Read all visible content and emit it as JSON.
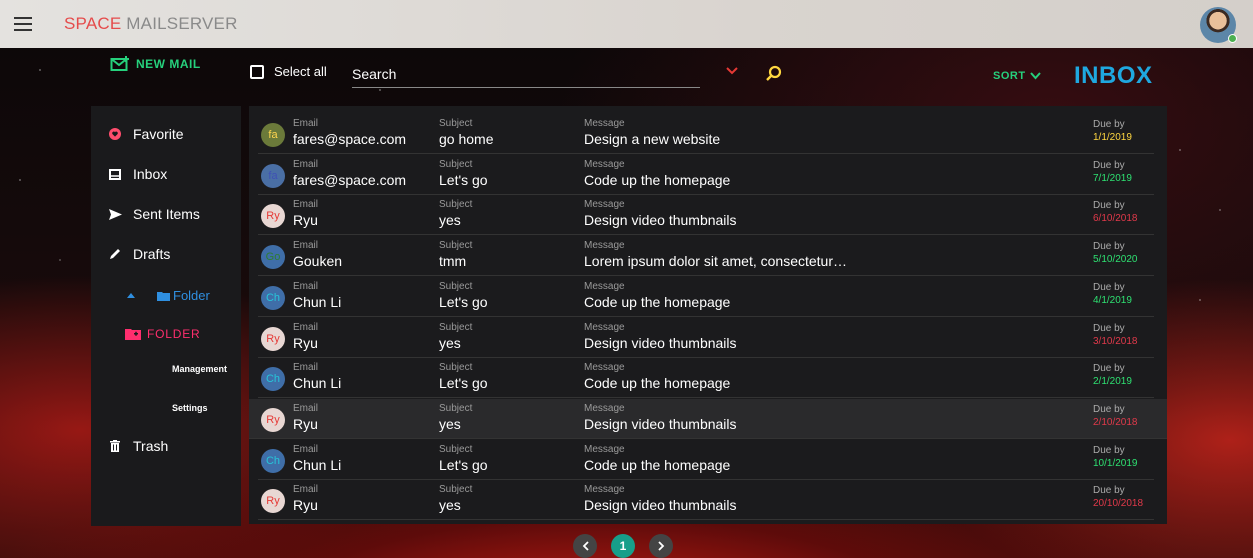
{
  "app": {
    "title_part1": "SPACE",
    "title_part2": " MAILSERVER"
  },
  "toolbar": {
    "new_mail": "NEW MAIL",
    "select_all": "Select all",
    "search_placeholder": "Search",
    "sort": "SORT",
    "inbox": "INBOX"
  },
  "sidebar": {
    "favorite": "Favorite",
    "inbox": "Inbox",
    "sent": "Sent Items",
    "drafts": "Drafts",
    "folder": "Folder",
    "folder2": "FOLDER",
    "management": "Management",
    "settings": "Settings",
    "trash": "Trash"
  },
  "labels": {
    "email": "Email",
    "subject": "Subject",
    "message": "Message",
    "due": "Due by"
  },
  "mails": [
    {
      "initials": "fa",
      "avatar_bg": "#6b7a3a",
      "avatar_fg": "#ffd54f",
      "email": "fares@space.com",
      "subject": "go home",
      "message": "Design a new website",
      "due": "1/1/2019",
      "due_color": "#ffd740"
    },
    {
      "initials": "fa",
      "avatar_bg": "#4a6fa5",
      "avatar_fg": "#3f51b5",
      "email": "fares@space.com",
      "subject": "Let's go",
      "message": "Code up the homepage",
      "due": "7/1/2019",
      "due_color": "#2ee071"
    },
    {
      "initials": "Ry",
      "avatar_bg": "#e8d7d3",
      "avatar_fg": "#e53935",
      "email": "Ryu",
      "subject": "yes",
      "message": "Design video thumbnails",
      "due": "6/10/2018",
      "due_color": "#e0394a"
    },
    {
      "initials": "Go",
      "avatar_bg": "#3f6ea8",
      "avatar_fg": "#2e7d32",
      "email": "Gouken",
      "subject": "tmm",
      "message": "Lorem ipsum dolor sit amet, consectetur…",
      "due": "5/10/2020",
      "due_color": "#2ee071"
    },
    {
      "initials": "Ch",
      "avatar_bg": "#3f6ea8",
      "avatar_fg": "#26c6da",
      "email": "Chun Li",
      "subject": "Let's go",
      "message": "Code up the homepage",
      "due": "4/1/2019",
      "due_color": "#2ee071"
    },
    {
      "initials": "Ry",
      "avatar_bg": "#e8d7d3",
      "avatar_fg": "#e53935",
      "email": "Ryu",
      "subject": "yes",
      "message": "Design video thumbnails",
      "due": "3/10/2018",
      "due_color": "#e0394a"
    },
    {
      "initials": "Ch",
      "avatar_bg": "#3f6ea8",
      "avatar_fg": "#26c6da",
      "email": "Chun Li",
      "subject": "Let's go",
      "message": "Code up the homepage",
      "due": "2/1/2019",
      "due_color": "#2ee071"
    },
    {
      "initials": "Ry",
      "avatar_bg": "#e8d7d3",
      "avatar_fg": "#e53935",
      "email": "Ryu",
      "subject": "yes",
      "message": "Design video thumbnails",
      "due": "2/10/2018",
      "due_color": "#e0394a"
    },
    {
      "initials": "Ch",
      "avatar_bg": "#3f6ea8",
      "avatar_fg": "#26c6da",
      "email": "Chun Li",
      "subject": "Let's go",
      "message": "Code up the homepage",
      "due": "10/1/2019",
      "due_color": "#2ee071"
    },
    {
      "initials": "Ry",
      "avatar_bg": "#e8d7d3",
      "avatar_fg": "#e53935",
      "email": "Ryu",
      "subject": "yes",
      "message": "Design video thumbnails",
      "due": "20/10/2018",
      "due_color": "#e0394a"
    }
  ],
  "pagination": {
    "current": "1"
  },
  "colors": {
    "accent_green": "#26d07c",
    "accent_blue": "#1fa8e0",
    "accent_pink": "#ff2e6e"
  }
}
